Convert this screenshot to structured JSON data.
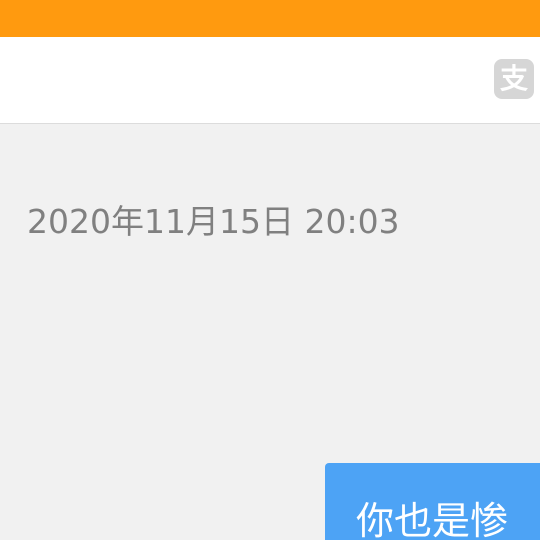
{
  "status_bar": {
    "color": "#ff9a0f"
  },
  "header": {
    "pay_icon": {
      "name": "alipay-icon",
      "glyph": "支"
    }
  },
  "chat": {
    "timestamp": "2020年11月15日 20:03",
    "messages": [
      {
        "side": "right",
        "text": "你也是惨",
        "bubble_color": "#4da3f5"
      }
    ]
  }
}
